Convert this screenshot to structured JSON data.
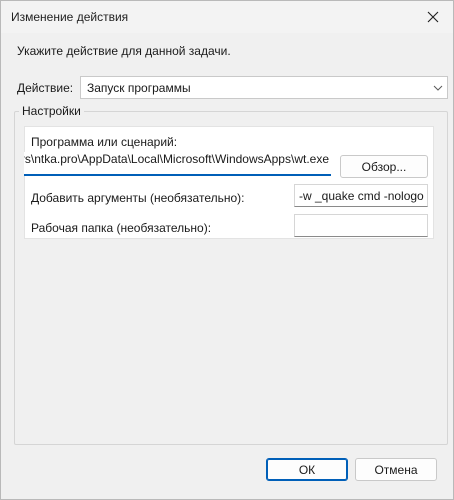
{
  "window": {
    "title": "Изменение действия"
  },
  "instruction": "Укажите действие для данной задачи.",
  "action": {
    "label": "Действие:",
    "selected": "Запуск программы"
  },
  "settings": {
    "legend": "Настройки",
    "program_label": "Программа или сценарий:",
    "program_value": "C:\\Users\\ntka.pro\\AppData\\Local\\Microsoft\\WindowsApps\\wt.exe",
    "browse_label": "Обзор...",
    "args_label": "Добавить аргументы (необязательно):",
    "args_value": "-w _quake cmd -nologo",
    "workdir_label": "Рабочая папка (необязательно):",
    "workdir_value": ""
  },
  "buttons": {
    "ok": "ОК",
    "cancel": "Отмена"
  },
  "icons": {
    "close": "close-icon",
    "dropdown": "chevron-down-icon"
  }
}
